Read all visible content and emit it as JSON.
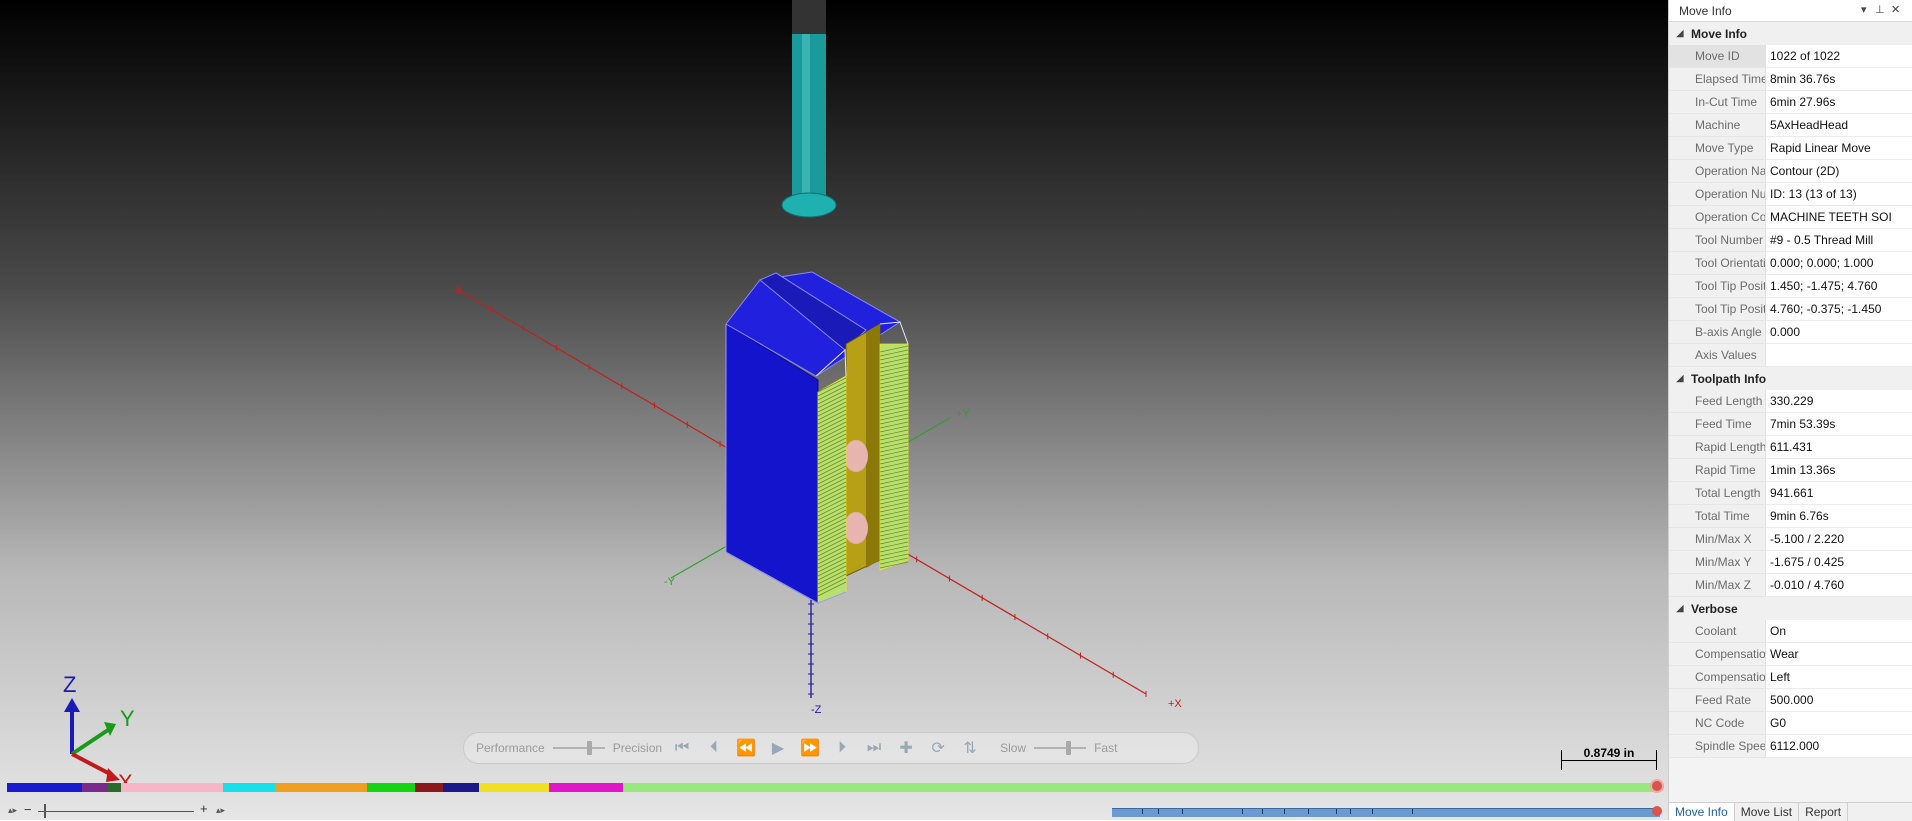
{
  "viewport": {
    "axis_labels": {
      "plus_x": "+X",
      "minus_x": "-X",
      "plus_y": "+Y",
      "minus_y": "-Y",
      "minus_z": "-Z"
    },
    "triad": {
      "z": "Z",
      "y": "Y",
      "x": "X"
    },
    "colors": {
      "part_blue": "#1414cc",
      "thread_green": "#b8e070",
      "slot_gold": "#b8a016",
      "tool_teal": "#1a9a9a",
      "tool_shank": "#3a3a3a"
    }
  },
  "playbar": {
    "performance": "Performance",
    "precision": "Precision",
    "slow": "Slow",
    "fast": "Fast",
    "buttons": [
      "skip-to-start-icon",
      "step-back-icon",
      "rewind-icon",
      "play-icon",
      "fast-forward-icon",
      "step-forward-icon",
      "skip-to-end-icon",
      "add-stop-icon",
      "loop-icon",
      "step-mode-icon"
    ]
  },
  "scale": {
    "text": "0.8749 in"
  },
  "timeline": {
    "segments": [
      {
        "color": "#1a1ad0",
        "weight": 75
      },
      {
        "color": "#7a2a8a",
        "weight": 25
      },
      {
        "color": "#2a6a2a",
        "weight": 14
      },
      {
        "color": "#f7b6c8",
        "weight": 102
      },
      {
        "color": "#16e0e8",
        "weight": 52
      },
      {
        "color": "#f0a020",
        "weight": 92
      },
      {
        "color": "#14d414",
        "weight": 48
      },
      {
        "color": "#8a1a1a",
        "weight": 28
      },
      {
        "color": "#1a1a8a",
        "weight": 36
      },
      {
        "color": "#f0e020",
        "weight": 70
      },
      {
        "color": "#e016c8",
        "weight": 74
      },
      {
        "color": "#98e880",
        "weight": 1034
      }
    ]
  },
  "zoom": {
    "minus": "−",
    "plus": "+"
  },
  "panel": {
    "title": "Move Info",
    "sections": [
      {
        "name": "Move Info",
        "rows": [
          {
            "k": "Move ID",
            "v": "1022 of 1022"
          },
          {
            "k": "Elapsed Time",
            "v": "8min 36.76s"
          },
          {
            "k": "In-Cut Time",
            "v": "6min 27.96s"
          },
          {
            "k": "Machine",
            "v": "5AxHeadHead"
          },
          {
            "k": "Move Type",
            "v": "Rapid Linear Move"
          },
          {
            "k": "Operation Name",
            "v": "Contour (2D)"
          },
          {
            "k": "Operation Nu...",
            "v": "ID: 13 (13 of 13)"
          },
          {
            "k": "Operation Com...",
            "v": "MACHINE TEETH SOI"
          },
          {
            "k": "Tool Number",
            "v": "#9 - 0.5 Thread Mill"
          },
          {
            "k": "Tool Orientation",
            "v": "0.000; 0.000; 1.000"
          },
          {
            "k": "Tool Tip Positio...",
            "v": "1.450; -1.475; 4.760"
          },
          {
            "k": "Tool Tip Positio...",
            "v": "4.760; -0.375; -1.450"
          },
          {
            "k": "B-axis Angle",
            "v": "0.000"
          },
          {
            "k": "Axis Values",
            "v": ""
          }
        ]
      },
      {
        "name": "Toolpath Info",
        "rows": [
          {
            "k": "Feed Length",
            "v": "330.229"
          },
          {
            "k": "Feed Time",
            "v": "7min 53.39s"
          },
          {
            "k": "Rapid Length",
            "v": "611.431"
          },
          {
            "k": "Rapid Time",
            "v": "1min 13.36s"
          },
          {
            "k": "Total Length",
            "v": "941.661"
          },
          {
            "k": "Total Time",
            "v": "9min 6.76s"
          },
          {
            "k": "Min/Max X",
            "v": "-5.100 / 2.220"
          },
          {
            "k": "Min/Max Y",
            "v": "-1.675 / 0.425"
          },
          {
            "k": "Min/Max Z",
            "v": "-0.010 / 4.760"
          }
        ]
      },
      {
        "name": "Verbose",
        "rows": [
          {
            "k": "Coolant",
            "v": "On"
          },
          {
            "k": "Compensation...",
            "v": "Wear"
          },
          {
            "k": "Compensation...",
            "v": "Left"
          },
          {
            "k": "Feed Rate",
            "v": "500.000"
          },
          {
            "k": "NC Code",
            "v": "G0"
          },
          {
            "k": "Spindle Speed",
            "v": "6112.000"
          }
        ]
      }
    ],
    "tabs": [
      "Move Info",
      "Move List",
      "Report"
    ]
  }
}
